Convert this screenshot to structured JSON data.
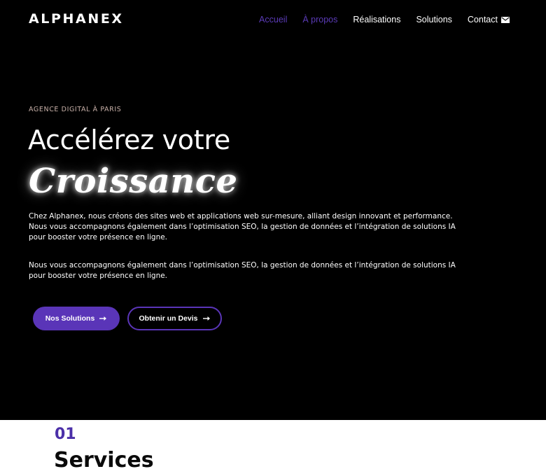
{
  "header": {
    "logo": "ALPHANEX",
    "nav": [
      {
        "label": "Accueil",
        "active": true
      },
      {
        "label": "À propos",
        "active": true
      },
      {
        "label": "Réalisations",
        "active": false
      },
      {
        "label": "Solutions",
        "active": false
      },
      {
        "label": "Contact",
        "active": false,
        "icon": "mail-icon"
      }
    ]
  },
  "hero": {
    "eyebrow": "AGENCE DIGITAL À PARIS",
    "headline": "Accélérez votre",
    "headline_accent": "Croissance",
    "paragraph_1": [
      "Chez Alphanex, nous créons des sites web et applications web sur-mesure, alliant design innovant et performance.",
      "Nous vous accompagnons également dans l’optimisation SEO, la gestion de données et l’intégration de solutions IA",
      "pour booster votre présence en ligne."
    ],
    "paragraph_2": [
      "Nous vous accompagnons également dans l’optimisation SEO, la gestion de données et l’intégration de solutions IA",
      "pour booster votre présence en ligne."
    ],
    "primary_button": {
      "label": "Nos Solutions",
      "icon": "arrow-right-icon"
    },
    "secondary_button": {
      "label": "Obtenir un Devis",
      "icon": "arrow-right-icon"
    }
  },
  "services": {
    "number": "01",
    "title": "Services"
  },
  "colors": {
    "accent": "#5a35b8",
    "nav_active": "#5b3bb8",
    "eyebrow": "#c9b1a9",
    "section_number": "#4b2fa8",
    "background": "#000000"
  }
}
